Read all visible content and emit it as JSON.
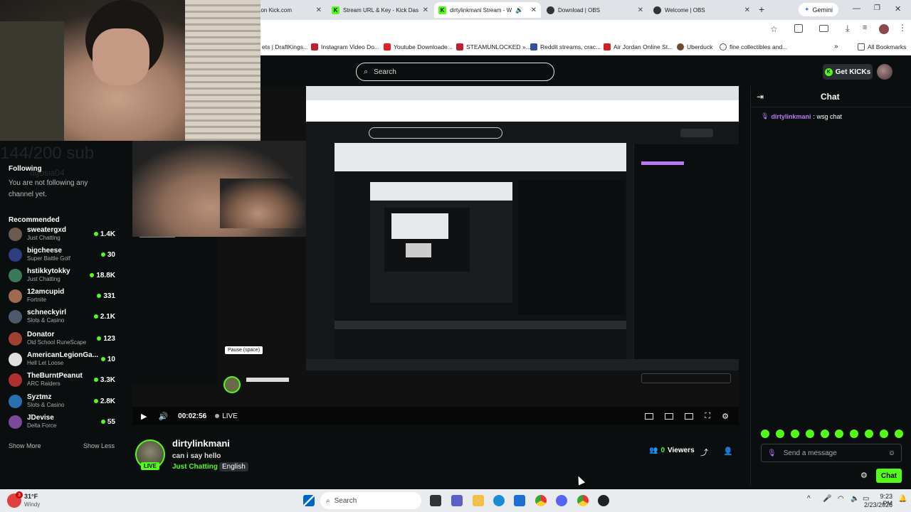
{
  "browser": {
    "tabs": [
      {
        "title": "ream on Kick.com",
        "active": false
      },
      {
        "title": "Stream URL & Key - Kick Das",
        "active": false
      },
      {
        "title": "dirtylinkmani Stream - W",
        "active": true
      },
      {
        "title": "Download | OBS",
        "active": false
      },
      {
        "title": "Welcome | OBS",
        "active": false
      }
    ],
    "new_tab": "+",
    "gemini": "Gemini",
    "bookmarks": [
      "ets | DraftKings...",
      "Instagram Video Do...",
      "Youtube Downloade...",
      "STEAMUNLOCKED »...",
      "Reddit streams, crac...",
      "Air Jordan Online St...",
      "Uberduck",
      "fine collectibles and..."
    ],
    "all_bookmarks": "All Bookmarks"
  },
  "header": {
    "search_placeholder": "Search",
    "get_kicks": "Get KICKs"
  },
  "sidebar": {
    "following_title": "Following",
    "following_empty": "You are not following any channel yet.",
    "recommended_title": "Recommended",
    "recommended": [
      {
        "name": "sweatergxd",
        "category": "Just Chatting",
        "viewers": "1.4K",
        "color": "#6b5a4e"
      },
      {
        "name": "bigcheese",
        "category": "Super Battle Golf",
        "viewers": "30",
        "color": "#2d3f80"
      },
      {
        "name": "hstikkytokky",
        "category": "Just Chatting",
        "viewers": "18.8K",
        "color": "#3a7a5a"
      },
      {
        "name": "12amcupid",
        "category": "Fortnite",
        "viewers": "331",
        "color": "#a06a50"
      },
      {
        "name": "schneckyirl",
        "category": "Slots & Casino",
        "viewers": "2.1K",
        "color": "#4a5a6a"
      },
      {
        "name": "Donator",
        "category": "Old School RuneScape",
        "viewers": "123",
        "color": "#a04030"
      },
      {
        "name": "AmericanLegionGa...",
        "category": "Hell Let Loose",
        "viewers": "10",
        "color": "#e0e0e0"
      },
      {
        "name": "TheBurntPeanut",
        "category": "ARC Raiders",
        "viewers": "3.3K",
        "color": "#b03030"
      },
      {
        "name": "Syztmz",
        "category": "Slots & Casino",
        "viewers": "2.8K",
        "color": "#2a70b0"
      },
      {
        "name": "JDevise",
        "category": "Delta Force",
        "viewers": "55",
        "color": "#7a4a9a"
      }
    ],
    "show_more": "Show More",
    "show_less": "Show Less"
  },
  "overlay_text": {
    "sub_goal": "144/200 sub",
    "goal_name": "dgosia04"
  },
  "player": {
    "time": "00:02:56",
    "live_label": "LIVE",
    "pause_tooltip": "Pause (space)"
  },
  "stream": {
    "channel": "dirtylinkmani",
    "title": "can i say hello",
    "category": "Just Chatting",
    "language": "English",
    "live_badge": "LIVE",
    "viewers_count": "0",
    "viewers_label": "Viewers"
  },
  "chat": {
    "title": "Chat",
    "messages": [
      {
        "user": "dirtylinkmani",
        "text": ": wsg chat"
      }
    ],
    "input_placeholder": "Send a message",
    "send_button": "Chat"
  },
  "taskbar": {
    "weather_temp": "31°F",
    "weather_desc": "Windy",
    "weather_badge": "3",
    "search": "Search",
    "time": "9:23 PM",
    "date": "2/23/2026"
  },
  "colors": {
    "kick_green": "#53fc18",
    "username_purple": "#b678f5",
    "bg": "#0b0e0f"
  }
}
